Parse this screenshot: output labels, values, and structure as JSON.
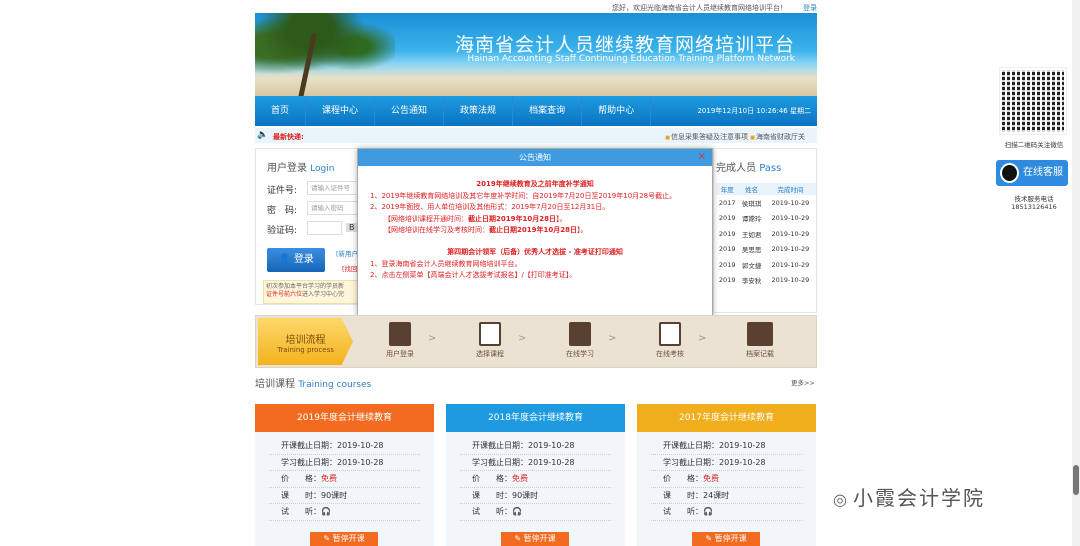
{
  "topbar": {
    "greeting": "您好，欢迎光临海南省会计人员继续教育网络培训平台！",
    "login": "登录"
  },
  "banner": {
    "title_cn": "海南省会计人员继续教育网络培训平台",
    "title_en": "Hainan Accounting Staff Continuing Education Training Platform Network"
  },
  "nav": {
    "items": [
      "首页",
      "课程中心",
      "公告通知",
      "政策法规",
      "档案查询",
      "帮助中心"
    ],
    "datetime": "2019年12月10日 10:26:46 星期二"
  },
  "ticker": {
    "label": "最新快递:",
    "links": [
      "信息采集答疑及注意事项",
      "海南省财政厅关"
    ]
  },
  "login": {
    "title": "用户登录",
    "title_en": "Login",
    "id_label": "证件号:",
    "id_placeholder": "请输入证件号",
    "pwd_label": "密　码:",
    "pwd_placeholder": "请输入密码",
    "captcha_label": "验证码:",
    "captcha_value": "B",
    "button": "登录",
    "new_user": "[新用户",
    "forgot": "[找回",
    "notice_a": "初次参加本平台学习的学员新",
    "notice_b": "证件号前六位",
    "notice_c": "进入学习中心完"
  },
  "pass": {
    "title": "完成人员",
    "title_en": "Pass",
    "headers": [
      "年度",
      "姓名",
      "完成时间"
    ],
    "rows": [
      [
        "2017",
        "侯琪琪",
        "2019-10-29"
      ],
      [
        "2019",
        "谭嫦玲",
        "2019-10-29"
      ],
      [
        "2019",
        "王如君",
        "2019-10-29"
      ],
      [
        "2019",
        "吴思思",
        "2019-10-29"
      ],
      [
        "2019",
        "郭文捷",
        "2019-10-29"
      ],
      [
        "2019",
        "李安秋",
        "2019-10-29"
      ]
    ]
  },
  "modal": {
    "title": "公告通知",
    "close": "×",
    "h1": "2019年继续教育及之前年度补学通知",
    "l1": "1、2019年继续教育网络培训及其它年度补学时间：自2019年7月20日至2019年10月28号截止。",
    "l2": "2、2019年面授、用人单位培训及其他形式：2019年7月20日至12月31日。",
    "l3a": "【网络培训课程开通时间：",
    "l3b": "截止日期2019年10月28日",
    "l3c": "】。",
    "l4a": "【网络培训在线学习及考核时间：",
    "l4b": "截止日期2019年10月28日",
    "l4c": "】。",
    "h2": "第四期会计领军（后备）优秀人才选拔 - 准考证打印通知",
    "m1": "1、登录海南省会计人员继续教育网络培训平台。",
    "m2": "2、点击左侧菜单【高端会计人才选拔考试报名】/【打印准考证】。"
  },
  "process": {
    "title": "培训流程",
    "title_en": "Training process",
    "steps": [
      "用户登录",
      "选择课程",
      "在线学习",
      "在线考核",
      "档案记载"
    ]
  },
  "courses": {
    "title": "培训课程",
    "title_en": "Training courses",
    "more": "更多>>",
    "cards": [
      {
        "name": "2019年度会计继续教育",
        "color": "#f36b21",
        "open_label": "开课截止日期：",
        "open": "2019-10-28",
        "study_label": "学习截止日期：",
        "study": "2019-10-28",
        "price_label": "价　　格：",
        "price": "免费",
        "hours_label": "课　　时：",
        "hours": "90课时",
        "trial_label": "试　　听：",
        "button": "暂停开课"
      },
      {
        "name": "2018年度会计继续教育",
        "color": "#1e9be0",
        "open_label": "开课截止日期：",
        "open": "2019-10-28",
        "study_label": "学习截止日期：",
        "study": "2019-10-28",
        "price_label": "价　　格：",
        "price": "免费",
        "hours_label": "课　　时：",
        "hours": "90课时",
        "trial_label": "试　　听：",
        "button": "暂停开课"
      },
      {
        "name": "2017年度会计继续教育",
        "color": "#f0ad1c",
        "open_label": "开课截止日期：",
        "open": "2019-10-28",
        "study_label": "学习截止日期：",
        "study": "2019-10-28",
        "price_label": "价　　格：",
        "price": "免费",
        "hours_label": "课　　时：",
        "hours": "24课时",
        "trial_label": "试　　听：",
        "button": "暂停开课"
      }
    ]
  },
  "side": {
    "qr_text": "扫描二维码关注微信",
    "service": "在线客服",
    "tech_label": "技术服务电话",
    "tech_phone": "18513126416"
  },
  "watermark": "小霞会计学院"
}
